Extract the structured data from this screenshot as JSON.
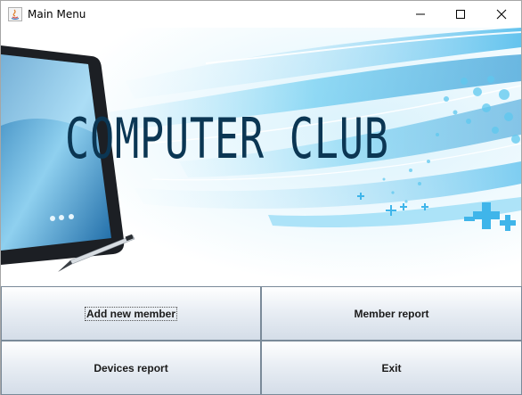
{
  "window": {
    "title": "Main Menu",
    "controls": {
      "minimize": "minimize",
      "maximize": "maximize",
      "close": "close"
    }
  },
  "banner": {
    "title": "COMPUTER CLUB",
    "colors": {
      "title": "#0b3653",
      "accent": "#5ec8ef",
      "deep": "#1a8fd0"
    }
  },
  "menu": {
    "add_member": "Add new member",
    "member_report": "Member report",
    "devices_report": "Devices report",
    "exit": "Exit"
  }
}
